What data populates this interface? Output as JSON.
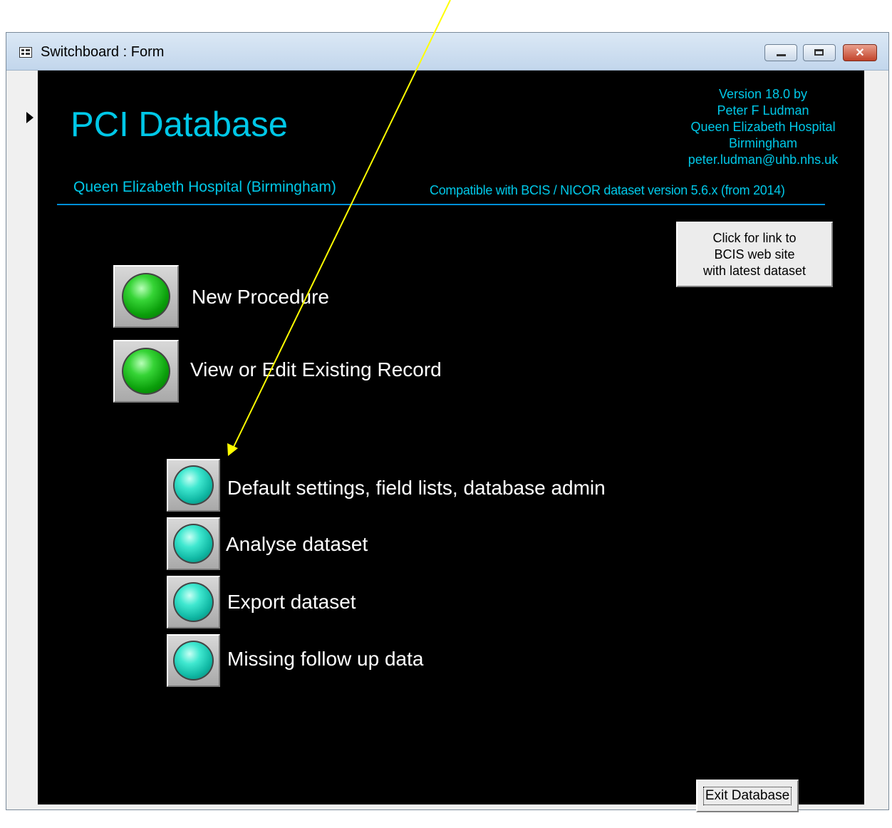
{
  "window": {
    "title": "Switchboard : Form",
    "close_glyph": "✕"
  },
  "header": {
    "app_title": "PCI Database",
    "hospital": "Queen Elizabeth Hospital (Birmingham)",
    "version_lines": [
      "Version 18.0 by",
      "Peter F Ludman",
      "Queen Elizabeth Hospital",
      "Birmingham",
      "peter.ludman@uhb.nhs.uk"
    ],
    "compatibility": "Compatible with BCIS / NICOR dataset version 5.6.x (from 2014)"
  },
  "bcis_link": {
    "lines": [
      "Click for link to",
      "BCIS web site",
      "with latest dataset"
    ]
  },
  "menu": {
    "new_procedure": "New Procedure",
    "view_edit": "View or Edit Existing Record",
    "defaults_admin": "Default settings, field lists, database admin",
    "analyse": "Analyse dataset",
    "export": "Export dataset",
    "missing_followup": "Missing follow up data"
  },
  "footer": {
    "exit_label": "Exit Database"
  },
  "colors": {
    "form_background": "#000000",
    "accent_text": "#00c8e8",
    "divider": "#0090d8",
    "primary_lamp": "#22c922",
    "secondary_lamp": "#20d0bc",
    "annotation_arrow": "#ffff00"
  }
}
